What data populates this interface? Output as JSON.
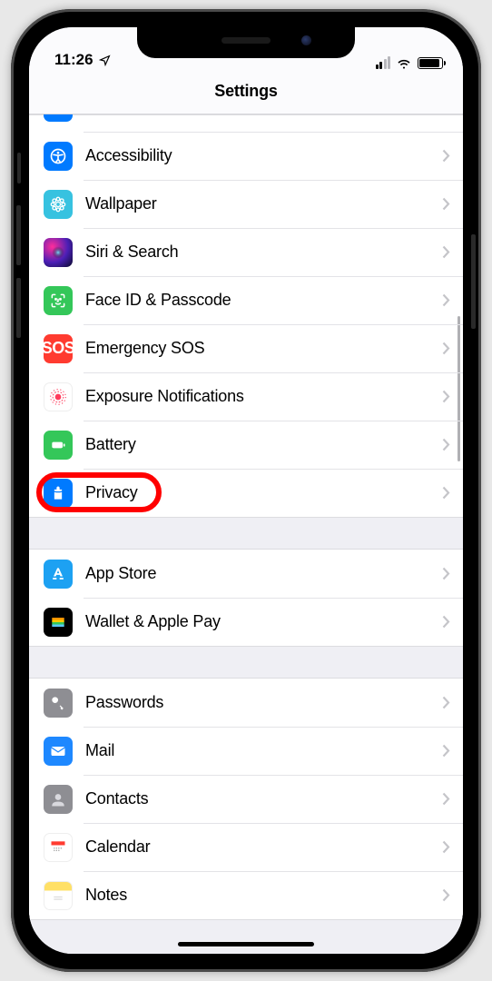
{
  "statusbar": {
    "time": "11:26"
  },
  "header": {
    "title": "Settings"
  },
  "groups": [
    {
      "items": [
        {
          "key": "partial",
          "label": ""
        },
        {
          "key": "accessibility",
          "label": "Accessibility"
        },
        {
          "key": "wallpaper",
          "label": "Wallpaper"
        },
        {
          "key": "siri",
          "label": "Siri & Search"
        },
        {
          "key": "faceid",
          "label": "Face ID & Passcode"
        },
        {
          "key": "sos",
          "label": "Emergency SOS",
          "glyph_text": "SOS"
        },
        {
          "key": "exposure",
          "label": "Exposure Notifications"
        },
        {
          "key": "battery",
          "label": "Battery"
        },
        {
          "key": "privacy",
          "label": "Privacy",
          "highlighted": true
        }
      ]
    },
    {
      "items": [
        {
          "key": "appstore",
          "label": "App Store"
        },
        {
          "key": "wallet",
          "label": "Wallet & Apple Pay"
        }
      ]
    },
    {
      "items": [
        {
          "key": "passwords",
          "label": "Passwords"
        },
        {
          "key": "mail",
          "label": "Mail"
        },
        {
          "key": "contacts",
          "label": "Contacts"
        },
        {
          "key": "calendar",
          "label": "Calendar"
        },
        {
          "key": "notes",
          "label": "Notes"
        }
      ]
    }
  ],
  "annotation": {
    "target": "privacy",
    "style": "red-rounded-ring"
  }
}
